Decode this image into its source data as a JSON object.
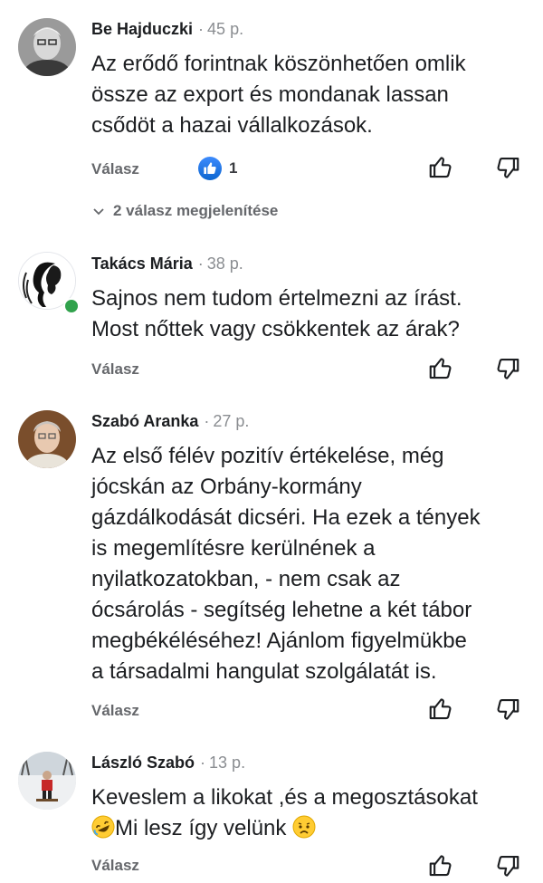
{
  "comments": [
    {
      "author": "Be Hajduczki",
      "time": "45 p.",
      "lines": [
        "Az erődő forintnak köszönhetően omlik",
        "össze az export és mondanak lassan",
        "csődöt a hazai vállalkozások."
      ],
      "reply_label": "Válasz",
      "like_count": "1",
      "replies_label": "2 válasz megjelenítése"
    },
    {
      "author": "Takács Mária",
      "time": "38 p.",
      "lines": [
        "Sajnos nem tudom értelmezni az írást.",
        "Most nőttek vagy csökkentek az árak?"
      ],
      "reply_label": "Válasz"
    },
    {
      "author": "Szabó Aranka",
      "time": "27 p.",
      "lines": [
        "Az első félév pozitív értékelése, még",
        "jócskán az Orbány-kormány",
        "gázdálkodását dicséri. Ha ezek a tények",
        "is  megemlítésre kerülnének a",
        "nyilatkozatokban, - nem csak az",
        "ócsárolás - segítség lehetne a két tábor",
        "megbékéléséhez! Ajánlom figyelmükbe",
        "a társadalmi hangulat szolgálatát is."
      ],
      "reply_label": "Válasz"
    },
    {
      "author": "László Szabó",
      "time": "13 p.",
      "lines": [
        "Keveslem a likokat ,és a megosztásokat",
        "Mi lesz így velünk"
      ],
      "reply_label": "Válasz"
    }
  ],
  "separator": "·",
  "colors": {
    "online": "#31a24c",
    "like_blue": "#1877f2",
    "muted": "#65676b"
  }
}
